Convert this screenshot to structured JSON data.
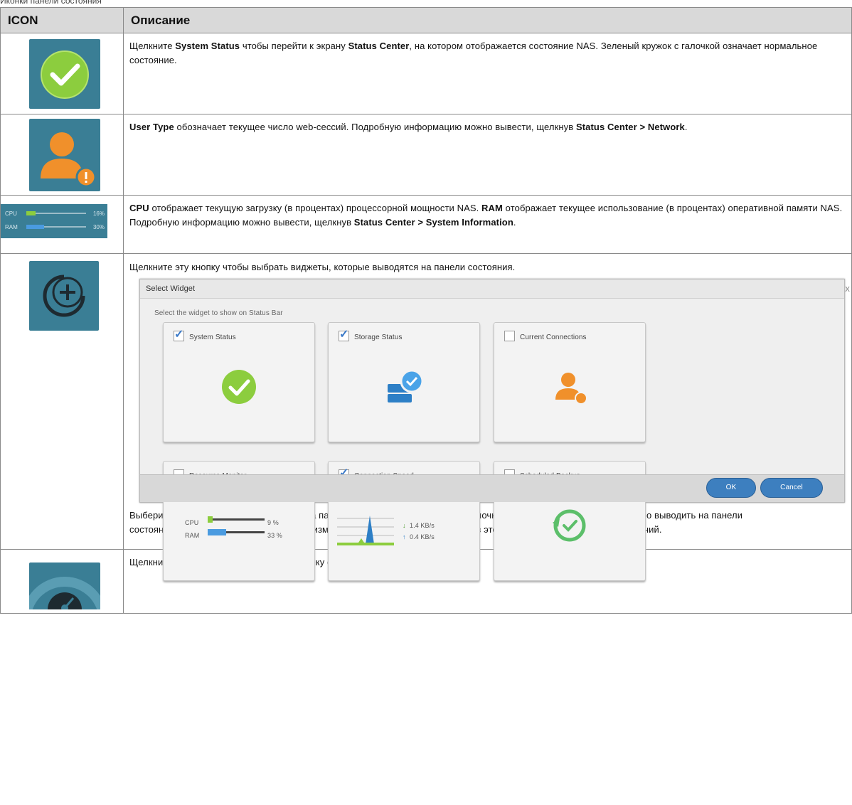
{
  "caption": "Иконки панели состояния",
  "table": {
    "col_icon": "ICON",
    "col_desc": "Описание"
  },
  "rows": {
    "r1": {
      "t1": "Щелкните ",
      "b1": "System Status",
      "t2": " чтобы перейти к экрану ",
      "b2": "Status Center",
      "t3": ", на котором отображается состояние NAS. Зеленый кружок с галочкой означает нормальное состояние."
    },
    "r2": {
      "b1": "User Type",
      "t1": " обозначает текущее число web-сессий. Подробную информацию можно вывести, щелкнув ",
      "b2": "Status Center > Network",
      "t2": "."
    },
    "r3": {
      "icon_cpu_label": "CPU",
      "icon_cpu_value": "16%",
      "icon_cpu_fraction": 0.16,
      "icon_ram_label": "RAM",
      "icon_ram_value": "30%",
      "icon_ram_fraction": 0.3,
      "b1": "CPU",
      "t1": " отображает текущую загрузку (в процентах) процессорной мощности NAS. ",
      "b2": "RAM",
      "t2": " отображает текущее использование (в процентах) оперативной памяти NAS. Подробную информацию можно вывести, щелкнув ",
      "b3": "Status Center > System Information",
      "t3": "."
    },
    "r4": {
      "intro": "Щелкните эту кнопку чтобы выбрать виджеты, которые выводятся на панели состояния.",
      "after": "Выберите виджеты, которые выводятся на панели состояния, либо сбросьте галочку у тех виджетов, которые не нужно выводить на панели состояния. Щелкните ОК для сохранения изменений либо Cancel для выхода из этого экрана без сохранения изменений."
    },
    "r5": {
      "text": "Щелкните чтобы скрыть или показать строку состояния."
    }
  },
  "dialog": {
    "title": "Select Widget",
    "close": "x",
    "subtitle": "Select the widget to show on Status Bar",
    "widgets": [
      {
        "label": "System Status",
        "checked": true
      },
      {
        "label": "Storage Status",
        "checked": true
      },
      {
        "label": "Current Connections",
        "checked": false
      },
      {
        "label": "Resource Monitor",
        "checked": false
      },
      {
        "label": "Connection Speed",
        "checked": true
      },
      {
        "label": "Scheduled Backup",
        "checked": false
      }
    ],
    "resource": {
      "cpu_label": "CPU",
      "cpu_value": "9 %",
      "cpu_fraction": 0.09,
      "ram_label": "RAM",
      "ram_value": "33 %",
      "ram_fraction": 0.33
    },
    "speed": {
      "down": "1.4 KB/s",
      "up": "0.4 KB/s"
    },
    "ok": "OK",
    "cancel": "Cancel"
  },
  "colors": {
    "tile": "#3a7e95",
    "green": "#8ccd3e",
    "orange": "#f0902b",
    "blue_btn": "#3d7fbf"
  }
}
